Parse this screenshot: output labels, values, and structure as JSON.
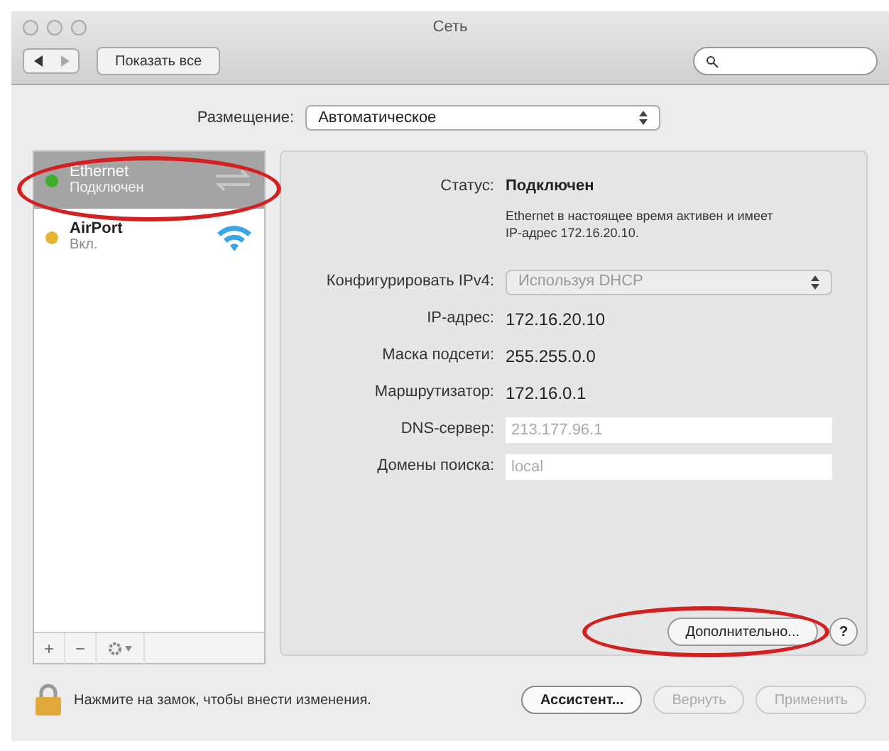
{
  "window": {
    "title": "Сеть"
  },
  "toolbar": {
    "show_all": "Показать все"
  },
  "location": {
    "label": "Размещение:",
    "value": "Автоматическое"
  },
  "services": [
    {
      "name": "Ethernet",
      "status": "Подключен",
      "color": "#3fae2a",
      "selected": true,
      "kind": "ethernet"
    },
    {
      "name": "AirPort",
      "status": "Вкл.",
      "color": "#e8b530",
      "selected": false,
      "kind": "wifi"
    }
  ],
  "list_buttons": [
    "+",
    "−"
  ],
  "status": {
    "label": "Статус:",
    "value": "Подключен",
    "description": "Ethernet в настоящее время активен и имеет IP-адрес 172.16.20.10."
  },
  "settings": [
    {
      "kind": "select",
      "label": "Конфигурировать IPv4:",
      "value": "Используя DHCP",
      "disabled": true
    },
    {
      "kind": "text",
      "label": "IP-адрес:",
      "value": "172.16.20.10"
    },
    {
      "kind": "text",
      "label": "Маска подсети:",
      "value": "255.255.0.0"
    },
    {
      "kind": "text",
      "label": "Маршрутизатор:",
      "value": "172.16.0.1"
    },
    {
      "kind": "field",
      "label": "DNS-сервер:",
      "placeholder": "213.177.96.1"
    },
    {
      "kind": "field",
      "label": "Домены поиска:",
      "placeholder": "local"
    }
  ],
  "advanced_button": "Дополнительно...",
  "help_button": "?",
  "lock_text": "Нажмите на замок, чтобы внести изменения.",
  "buttons": [
    {
      "label": "Ассистент...",
      "disabled": false
    },
    {
      "label": "Вернуть",
      "disabled": true
    },
    {
      "label": "Применить",
      "disabled": true
    }
  ]
}
